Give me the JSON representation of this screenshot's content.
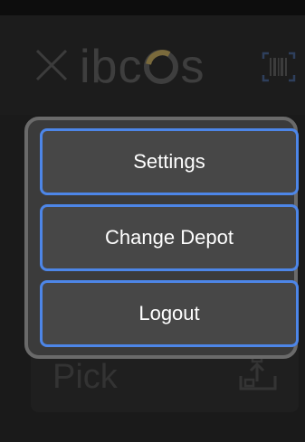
{
  "header": {
    "logo_text_pre": "ibc",
    "logo_text_post": "s",
    "close_icon": "close-x-icon",
    "barcode_icon": "barcode-scanner-icon",
    "accent_logo_ring": "#7a6a3c"
  },
  "background": {
    "card_label": "Pick",
    "card_icon": "upload-tray-icon"
  },
  "menu": {
    "items": [
      {
        "label": "Settings"
      },
      {
        "label": "Change Depot"
      },
      {
        "label": "Logout"
      }
    ],
    "button_border_color": "#4d86e8"
  }
}
